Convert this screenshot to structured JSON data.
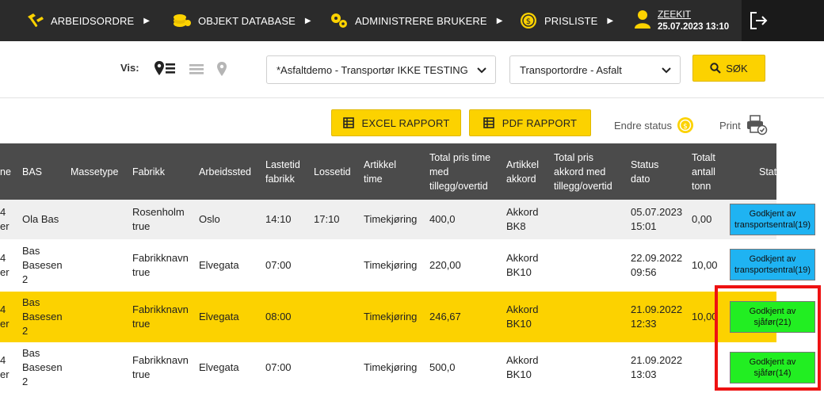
{
  "nav": {
    "items": [
      {
        "label": "ARBEIDSORDRE",
        "icon": "hammer-icon"
      },
      {
        "label": "OBJEKT DATABASE",
        "icon": "coins-icon"
      },
      {
        "label": "ADMINISTRERE BRUKERE",
        "icon": "gears-icon"
      },
      {
        "label": "PRISLISTE",
        "icon": "money-icon"
      }
    ],
    "user": {
      "name": "ZEEKIT",
      "datetime": "25.07.2023 13:10",
      "icon": "user-icon"
    },
    "logout_icon": "logout-icon"
  },
  "filter": {
    "vis_label": "Vis:",
    "company_select": "*Asfaltdemo - Transportør IKKE TESTING",
    "type_select": "Transportordre - Asfalt",
    "search_label": "SØK"
  },
  "actions": {
    "excel_label": "EXCEL RAPPORT",
    "pdf_label": "PDF RAPPORT",
    "endre_label": "Endre status",
    "print_label": "Print"
  },
  "table": {
    "headers": {
      "c0": "ne",
      "bas": "BAS",
      "massetype": "Massetype",
      "fabrikk": "Fabrikk",
      "arbeidssted": "Arbeidssted",
      "lastetid": "Lastetid fabrikk",
      "lossetid": "Lossetid",
      "art_time": "Artikkel time",
      "total_time": "Total pris time med tillegg/overtid",
      "art_akkord": "Artikkel akkord",
      "total_akkord": "Total pris akkord med tillegg/overtid",
      "status_dato": "Status dato",
      "totalt_tonn": "Totalt antall tonn",
      "status": "Status"
    },
    "rows": [
      {
        "c0": "4 er",
        "bas": "Ola Bas",
        "fabrikk": "Rosenholm true",
        "arbeidssted": "Oslo",
        "lastetid": "14:10",
        "lossetid": "17:10",
        "art_time": "Timekjøring",
        "total_time": "400,0",
        "art_akkord": "Akkord BK8",
        "status_dato": "05.07.2023 15:01",
        "tonn": "0,00",
        "status": "Godkjent av transportsentral(19)",
        "status_color": "#1fb3f2"
      },
      {
        "c0": "4 er",
        "bas": "Bas Basesen 2",
        "fabrikk": "Fabrikknavn true",
        "arbeidssted": "Elvegata",
        "lastetid": "07:00",
        "lossetid": "",
        "art_time": "Timekjøring",
        "total_time": "220,00",
        "art_akkord": "Akkord BK10",
        "status_dato": "22.09.2022 09:56",
        "tonn": "10,00",
        "status": "Godkjent av transportsentral(19)",
        "status_color": "#1fb3f2"
      },
      {
        "c0": "4 er",
        "bas": "Bas Basesen 2",
        "fabrikk": "Fabrikknavn true",
        "arbeidssted": "Elvegata",
        "lastetid": "08:00",
        "lossetid": "",
        "art_time": "Timekjøring",
        "total_time": "246,67",
        "art_akkord": "Akkord BK10",
        "status_dato": "21.09.2022 12:33",
        "tonn": "10,00",
        "status": "Godkjent av sjåfør(21)",
        "status_color": "#22ee22"
      },
      {
        "c0": "4 er",
        "bas": "Bas Basesen 2",
        "fabrikk": "Fabrikknavn true",
        "arbeidssted": "Elvegata",
        "lastetid": "07:00",
        "lossetid": "",
        "art_time": "Timekjøring",
        "total_time": "500,0",
        "art_akkord": "Akkord BK10",
        "status_dato": "21.09.2022 13:03",
        "tonn": "",
        "status": "Godkjent av sjåfør(14)",
        "status_color": "#22ee22"
      }
    ]
  },
  "colors": {
    "accent": "#fcd200",
    "nav_bg": "#2b2b2b",
    "header_bg": "#4b4b4b",
    "highlight": "#ee1111"
  }
}
